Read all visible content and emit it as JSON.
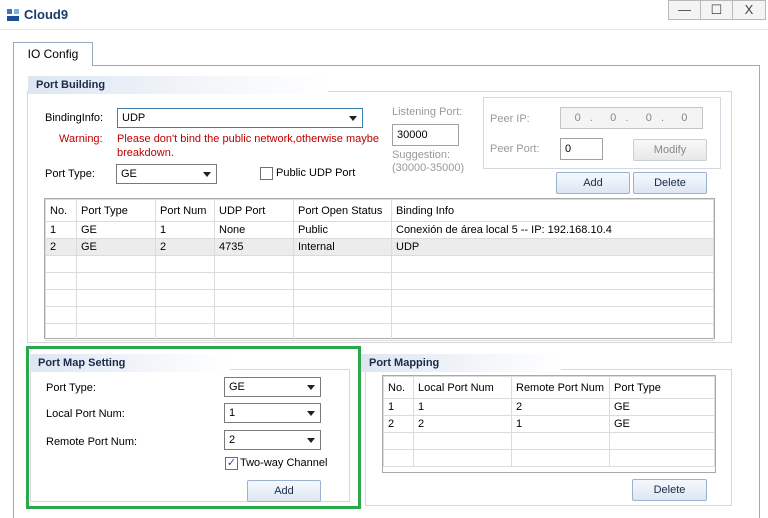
{
  "window": {
    "title": "Cloud9",
    "min_glyph": "—",
    "max_glyph": "☐",
    "close_glyph": "X",
    "icon": "cloud9-app-icon"
  },
  "tabs": [
    {
      "label": "IO Config",
      "active": true
    }
  ],
  "port_building": {
    "title": "Port Building",
    "binding_info_label": "BindingInfo:",
    "binding_info_value": "UDP",
    "warning_label": "Warning:",
    "warning_text_1": "Please don't bind the public network,otherwise maybe",
    "warning_text_2": "breakdown.",
    "port_type_label": "Port Type:",
    "port_type_value": "GE",
    "public_udp_label": "Public UDP Port",
    "public_udp_checked": false,
    "listening_port_label": "Listening Port:",
    "listening_port_value": "30000",
    "suggestion_label": "Suggestion:",
    "suggestion_range": "(30000-35000)",
    "peer_ip_label": "Peer IP:",
    "peer_ip_value": [
      "0",
      "0",
      "0",
      "0"
    ],
    "peer_port_label": "Peer Port:",
    "peer_port_value": "0",
    "modify_label": "Modify",
    "add_label": "Add",
    "delete_label": "Delete",
    "table": {
      "columns": [
        "No.",
        "Port Type",
        "Port Num",
        "UDP Port",
        "Port Open Status",
        "Binding Info"
      ],
      "rows": [
        [
          "1",
          "GE",
          "1",
          "None",
          "Public",
          "Conexión de área local 5 -- IP: 192.168.10.4"
        ],
        [
          "2",
          "GE",
          "2",
          "4735",
          "Internal",
          "UDP"
        ]
      ]
    }
  },
  "port_map_setting": {
    "title": "Port Map Setting",
    "port_type_label": "Port Type:",
    "port_type_value": "GE",
    "local_port_label": "Local Port Num:",
    "local_port_value": "1",
    "remote_port_label": "Remote Port Num:",
    "remote_port_value": "2",
    "two_way_label": "Two-way Channel",
    "two_way_checked": true,
    "check_glyph": "✓",
    "add_label": "Add"
  },
  "port_mapping": {
    "title": "Port Mapping",
    "delete_label": "Delete",
    "table": {
      "columns": [
        "No.",
        "Local Port Num",
        "Remote Port Num",
        "Port Type"
      ],
      "rows": [
        [
          "1",
          "1",
          "2",
          "GE"
        ],
        [
          "2",
          "2",
          "1",
          "GE"
        ]
      ]
    }
  },
  "colors": {
    "highlight_frame": "#2aa84a",
    "warning": "#c00000",
    "title": "#1a3a6e"
  }
}
